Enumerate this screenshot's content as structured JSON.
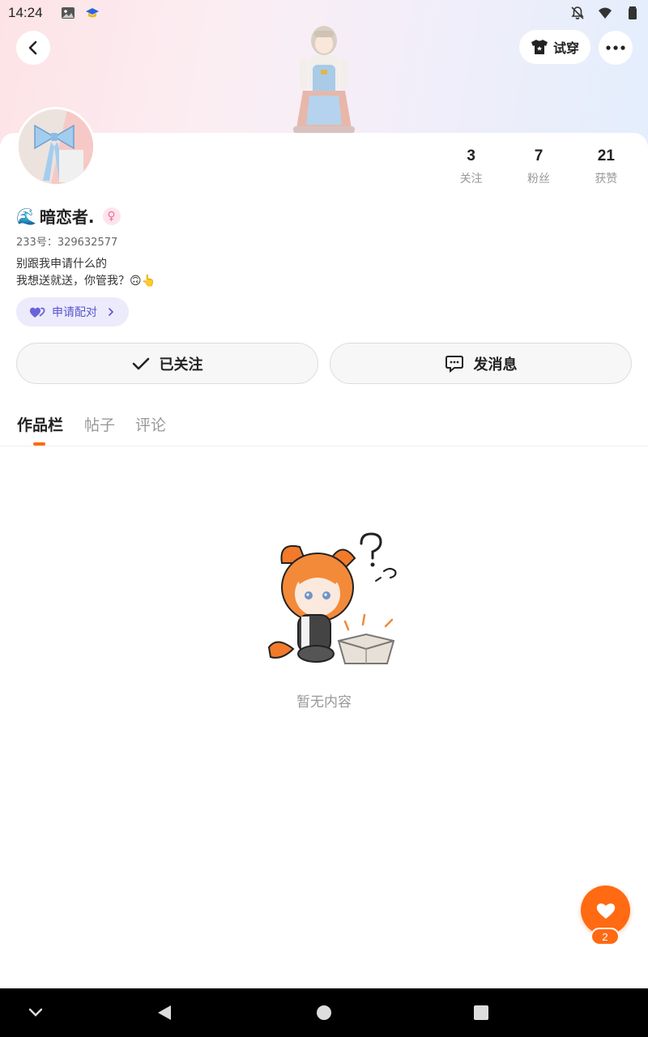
{
  "status_bar": {
    "time": "14:24",
    "left_icons": [
      "image-icon",
      "graduation-cap-icon"
    ],
    "right_icons": [
      "notifications-off-icon",
      "wifi-icon",
      "battery-icon"
    ]
  },
  "header": {
    "try_on_label": "试穿"
  },
  "stats": [
    {
      "value": "3",
      "label": "关注"
    },
    {
      "value": "7",
      "label": "粉丝"
    },
    {
      "value": "21",
      "label": "获赞"
    }
  ],
  "profile": {
    "name_emoji": "🌊",
    "name": "暗恋者.",
    "uid": "233号：329632577",
    "bio_line1": "别跟我申请什么的",
    "bio_line2": "我想送就送，你管我？🙃👆"
  },
  "pair_button": {
    "label": "申请配对"
  },
  "actions": {
    "follow_label": "已关注",
    "message_label": "发消息"
  },
  "tabs": [
    {
      "label": "作品栏",
      "active": true
    },
    {
      "label": "帖子",
      "active": false
    },
    {
      "label": "评论",
      "active": false
    }
  ],
  "empty_state": {
    "text": "暂无内容"
  },
  "fab": {
    "count": "2"
  },
  "colors": {
    "accent": "#ff6a13",
    "pair_text": "#5a55d0",
    "pair_bg": "#ecebfb"
  }
}
